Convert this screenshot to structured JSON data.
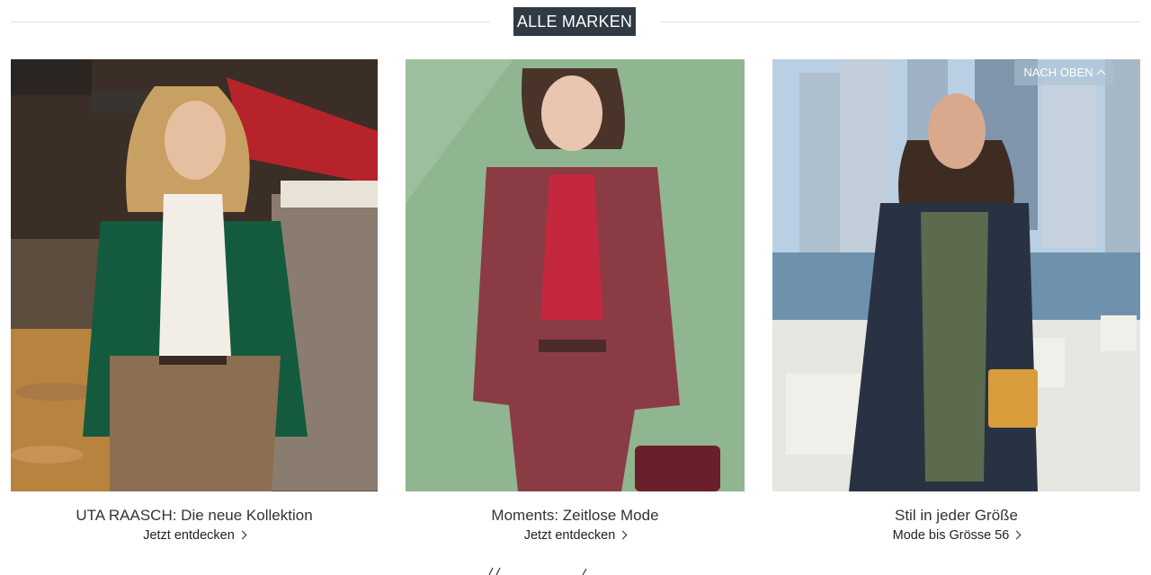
{
  "header": {
    "brands_button": "ALLE MARKEN"
  },
  "scroll_top": {
    "label": "NACH OBEN"
  },
  "cards": [
    {
      "title": "UTA RAASCH: Die neue Kollektion",
      "link": "Jetzt entdecken",
      "image": "woman in green velvet blazer on cafe street"
    },
    {
      "title": "Moments: Zeitlose Mode",
      "link": "Jetzt entdecken",
      "image": "woman in burgundy suit against green wall"
    },
    {
      "title": "Stil in jeder Größe",
      "link": "Mode bis Grösse 56",
      "image": "woman in navy cardigan by waterfront skyline"
    }
  ],
  "colors": {
    "brand_button_bg": "#2f3a44",
    "rule": "#e3e3e3"
  }
}
